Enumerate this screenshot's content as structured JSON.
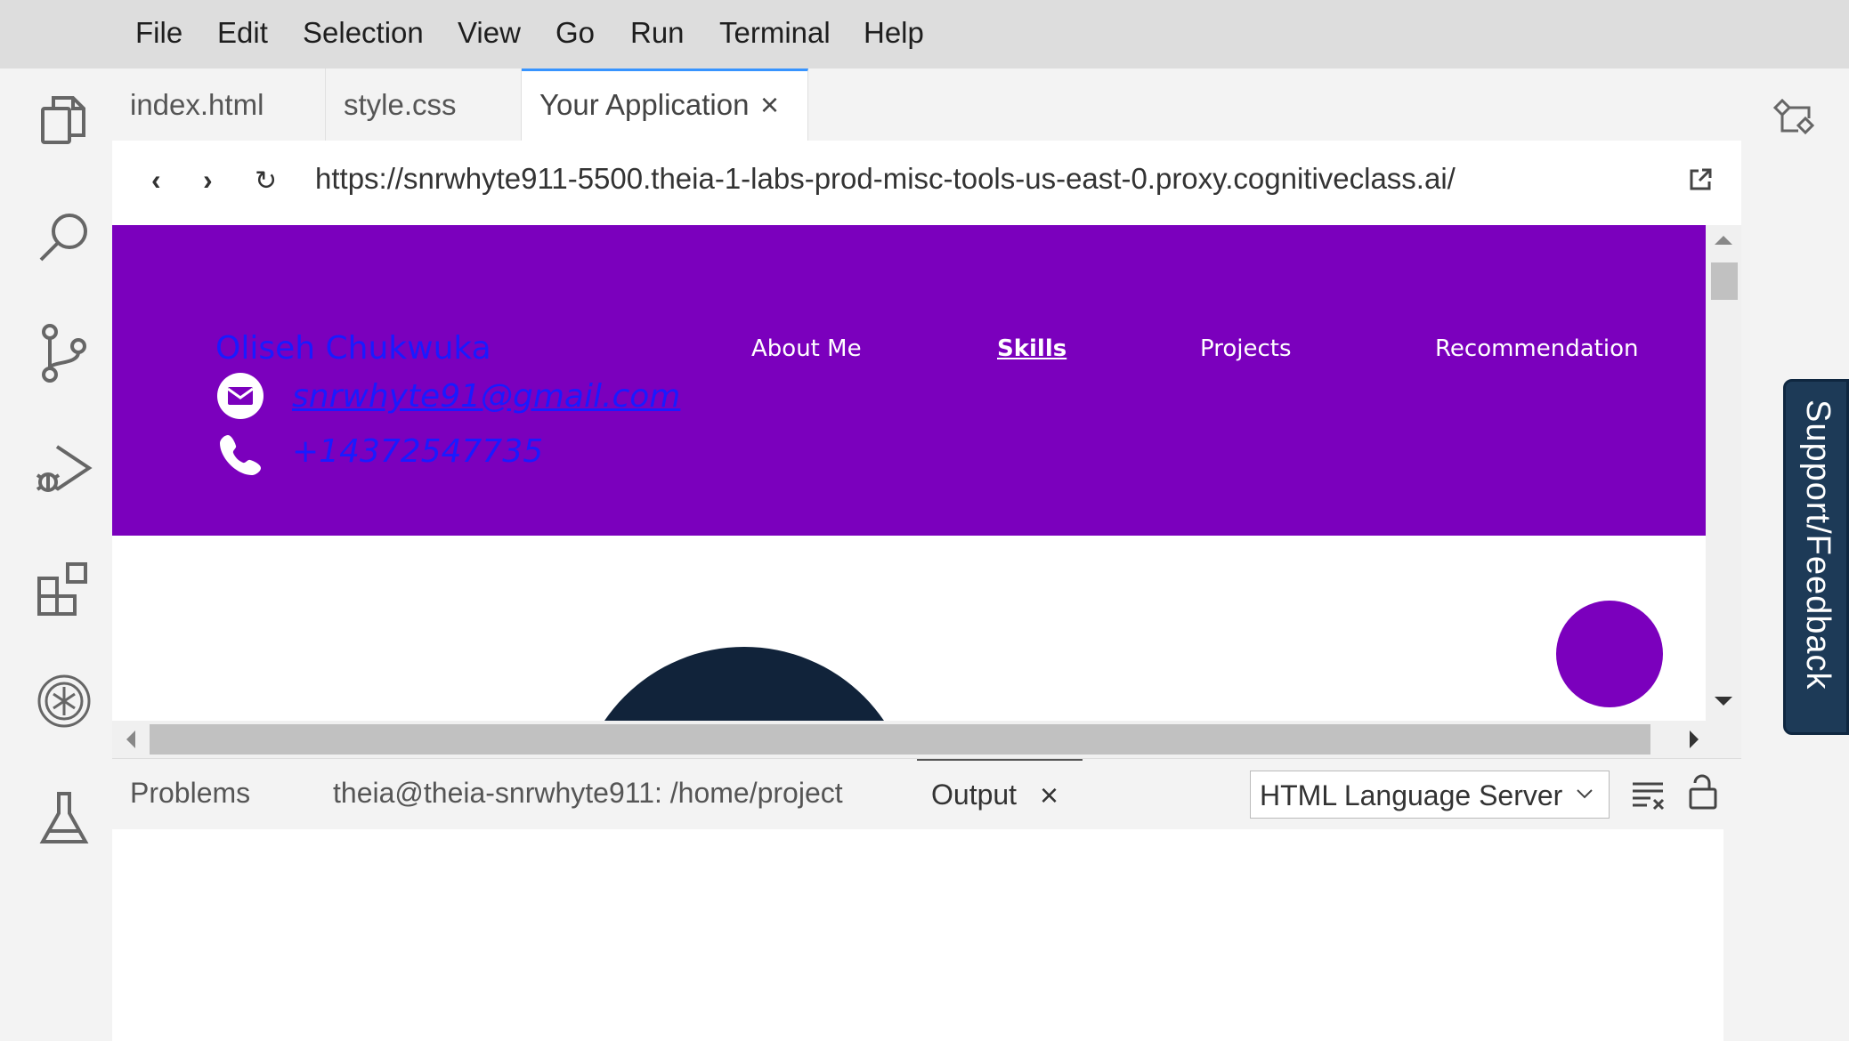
{
  "menu": [
    "File",
    "Edit",
    "Selection",
    "View",
    "Go",
    "Run",
    "Terminal",
    "Help"
  ],
  "tabs": [
    {
      "label": "index.html"
    },
    {
      "label": "style.css"
    },
    {
      "label": "Your Application"
    }
  ],
  "browser": {
    "url": "https://snrwhyte911-5500.theia-1-labs-prod-misc-tools-us-east-0.proxy.cognitiveclass.ai/"
  },
  "site": {
    "name": "Oliseh Chukwuka",
    "email": "snrwhyte91@gmail.com",
    "phone": "+14372547735",
    "nav": [
      "About Me",
      "Skills",
      "Projects",
      "Recommendation"
    ],
    "accent": "#7b00bd"
  },
  "panel": {
    "tabs": [
      "Problems",
      "theia@theia-snrwhyte911: /home/project",
      "Output"
    ],
    "channel": "HTML Language Server"
  },
  "support_label": "Support/Feedback"
}
